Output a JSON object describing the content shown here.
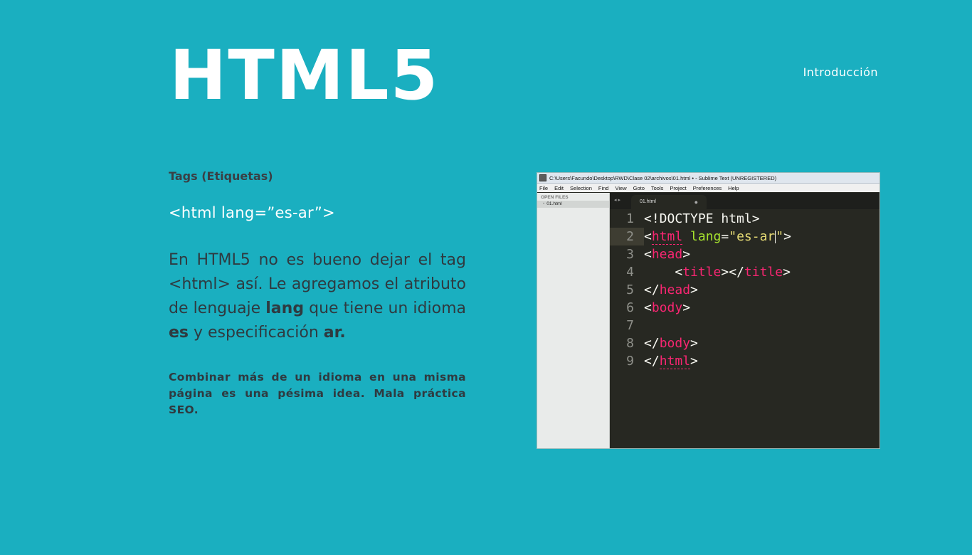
{
  "slide": {
    "title": "HTML5",
    "section": "Introducción"
  },
  "content": {
    "subheading": "Tags (Etiquetas)",
    "code_sample": "<html lang=”es-ar”>",
    "paragraph": {
      "part1": "En HTML5 no es bueno dejar el tag <html> así. Le agregamos el atributo de lenguaje ",
      "bold1": "lang",
      "part2": " que tiene un idioma ",
      "bold2": "es",
      "part3": " y especificación ",
      "bold3": "ar."
    },
    "warning": "Combinar más de un idioma en una misma página es una pésima idea. Mala práctica SEO."
  },
  "editor": {
    "window_title": "C:\\Users\\Facundo\\Desktop\\RWD\\Clase 02\\archivos\\01.html • - Sublime Text (UNREGISTERED)",
    "menu": [
      "File",
      "Edit",
      "Selection",
      "Find",
      "View",
      "Goto",
      "Tools",
      "Project",
      "Preferences",
      "Help"
    ],
    "sidebar_header": "OPEN FILES",
    "open_file": "01.html",
    "tab_label": "01.html",
    "tab_arrows": "◂ ▸",
    "tab_dirty": "●",
    "line_numbers": [
      "1",
      "2",
      "3",
      "4",
      "5",
      "6",
      "7",
      "8",
      "9"
    ],
    "code": {
      "l1": "<!DOCTYPE html>",
      "lt": "<",
      "gt": ">",
      "ltslash": "</",
      "html": "html",
      "head": "head",
      "title": "title",
      "body": "body",
      "lang": "lang",
      "eq": "=",
      "str_open": "\"es-ar",
      "str_close": "\"",
      "space": " ",
      "indent": "    "
    },
    "colors": {
      "background": "#272822",
      "tag": "#f92672",
      "attribute": "#a6e22e",
      "string": "#e6db74"
    }
  },
  "colors": {
    "slide_background": "#1aafc0",
    "title": "#ffffff",
    "body_text": "#2f3a40"
  }
}
